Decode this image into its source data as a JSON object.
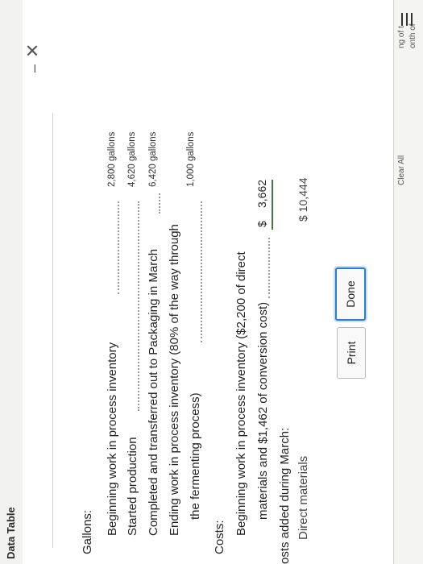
{
  "window": {
    "title": "Data Table",
    "minimize": "–",
    "close": "✕"
  },
  "gallons": {
    "header": "Gallons:",
    "rows": [
      {
        "label": "Beginning work in process inventory",
        "value": "2,800 gallons"
      },
      {
        "label": "Started production",
        "value": "4,620 gallons"
      },
      {
        "label": "Completed and transferred out to Packaging in March",
        "value": "6,420 gallons"
      },
      {
        "label": "Ending work in process inventory (80% of the way through",
        "label2": "the fermenting process)",
        "value": "1,000 gallons"
      }
    ]
  },
  "costs": {
    "header": "Costs:",
    "beginning_label_1": "Beginning work in process inventory ($2,200 of direct",
    "beginning_label_2": "materials and $1,462 of conversion cost)",
    "beginning_currency": "$",
    "beginning_value": "3,662",
    "added_header": "osts added during March:",
    "cut_off_line": "Direct materials",
    "cut_off_value": "$ 10,444"
  },
  "buttons": {
    "print": "Print",
    "done": "Done"
  },
  "background_window": {
    "text_1": "ng of t",
    "text_2": "onth of",
    "partial_button": "Clear All"
  }
}
